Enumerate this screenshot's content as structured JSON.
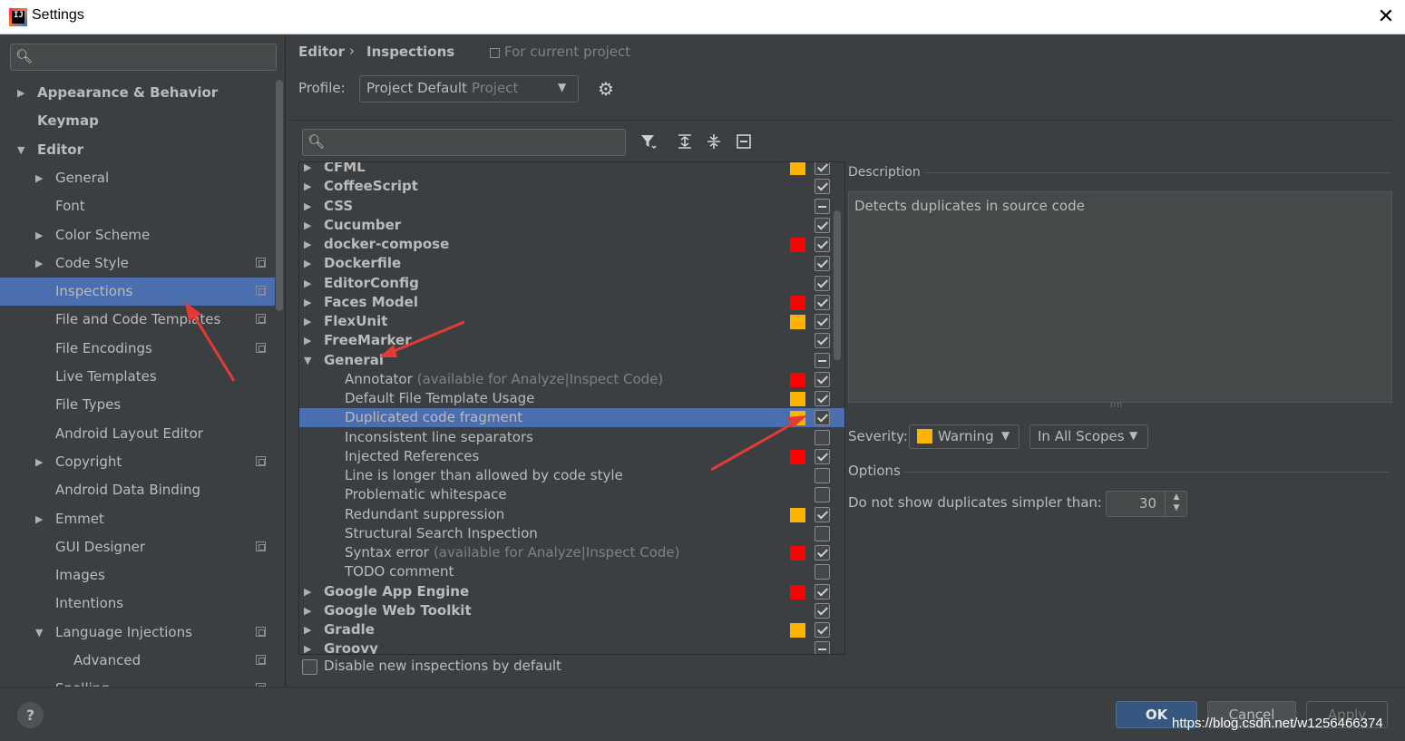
{
  "window": {
    "title": "Settings",
    "close_glyph": "✕"
  },
  "left": {
    "search_placeholder": "",
    "items": [
      {
        "label": "Appearance & Behavior",
        "level": 0,
        "arrow": "▶",
        "bold": true
      },
      {
        "label": "Keymap",
        "level": 0,
        "arrow": "",
        "bold": true
      },
      {
        "label": "Editor",
        "level": 0,
        "arrow": "▼",
        "bold": true
      },
      {
        "label": "General",
        "level": 1,
        "arrow": "▶"
      },
      {
        "label": "Font",
        "level": 1,
        "arrow": ""
      },
      {
        "label": "Color Scheme",
        "level": 1,
        "arrow": "▶"
      },
      {
        "label": "Code Style",
        "level": 1,
        "arrow": "▶",
        "project": true
      },
      {
        "label": "Inspections",
        "level": 1,
        "arrow": "",
        "project": true,
        "selected": true
      },
      {
        "label": "File and Code Templates",
        "level": 1,
        "arrow": "",
        "project": true
      },
      {
        "label": "File Encodings",
        "level": 1,
        "arrow": "",
        "project": true
      },
      {
        "label": "Live Templates",
        "level": 1,
        "arrow": ""
      },
      {
        "label": "File Types",
        "level": 1,
        "arrow": ""
      },
      {
        "label": "Android Layout Editor",
        "level": 1,
        "arrow": ""
      },
      {
        "label": "Copyright",
        "level": 1,
        "arrow": "▶",
        "project": true
      },
      {
        "label": "Android Data Binding",
        "level": 1,
        "arrow": ""
      },
      {
        "label": "Emmet",
        "level": 1,
        "arrow": "▶"
      },
      {
        "label": "GUI Designer",
        "level": 1,
        "arrow": "",
        "project": true
      },
      {
        "label": "Images",
        "level": 1,
        "arrow": ""
      },
      {
        "label": "Intentions",
        "level": 1,
        "arrow": ""
      },
      {
        "label": "Language Injections",
        "level": 1,
        "arrow": "▼",
        "project": true
      },
      {
        "label": "Advanced",
        "level": 2,
        "arrow": "",
        "project": true
      },
      {
        "label": "Spelling",
        "level": 1,
        "arrow": "",
        "project": true
      }
    ]
  },
  "header": {
    "breadcrumb_editor": "Editor",
    "breadcrumb_sep": "›",
    "breadcrumb_inspections": "Inspections",
    "scope_note": "For current project",
    "profile_label": "Profile:",
    "profile_value": "Project Default",
    "profile_scope": "Project"
  },
  "inspections": [
    {
      "label": "CFML",
      "type": "group",
      "arrow": "▶",
      "severity": "#fdb400",
      "check": "checked"
    },
    {
      "label": "CoffeeScript",
      "type": "group",
      "arrow": "▶",
      "severity": "",
      "check": "checked"
    },
    {
      "label": "CSS",
      "type": "group",
      "arrow": "▶",
      "severity": "",
      "check": "mixed"
    },
    {
      "label": "Cucumber",
      "type": "group",
      "arrow": "▶",
      "severity": "",
      "check": "checked"
    },
    {
      "label": "docker-compose",
      "type": "group",
      "arrow": "▶",
      "severity": "#ff0000",
      "check": "checked"
    },
    {
      "label": "Dockerfile",
      "type": "group",
      "arrow": "▶",
      "severity": "",
      "check": "checked"
    },
    {
      "label": "EditorConfig",
      "type": "group",
      "arrow": "▶",
      "severity": "",
      "check": "checked"
    },
    {
      "label": "Faces Model",
      "type": "group",
      "arrow": "▶",
      "severity": "#ff0000",
      "check": "checked"
    },
    {
      "label": "FlexUnit",
      "type": "group",
      "arrow": "▶",
      "severity": "#fdb400",
      "check": "checked"
    },
    {
      "label": "FreeMarker",
      "type": "group",
      "arrow": "▶",
      "severity": "",
      "check": "checked"
    },
    {
      "label": "General",
      "type": "group",
      "arrow": "▼",
      "severity": "",
      "check": "mixed"
    },
    {
      "label": "Annotator",
      "note": "(available for Analyze|Inspect Code)",
      "type": "child",
      "severity": "#ff0000",
      "check": "checked"
    },
    {
      "label": "Default File Template Usage",
      "type": "child",
      "severity": "#fdb400",
      "check": "checked"
    },
    {
      "label": "Duplicated code fragment",
      "type": "child",
      "severity": "#fdb400",
      "check": "checked",
      "selected": true
    },
    {
      "label": "Inconsistent line separators",
      "type": "child",
      "severity": "",
      "check": "unchecked"
    },
    {
      "label": "Injected References",
      "type": "child",
      "severity": "#ff0000",
      "check": "checked"
    },
    {
      "label": "Line is longer than allowed by code style",
      "type": "child",
      "severity": "",
      "check": "unchecked"
    },
    {
      "label": "Problematic whitespace",
      "type": "child",
      "severity": "",
      "check": "unchecked"
    },
    {
      "label": "Redundant suppression",
      "type": "child",
      "severity": "#fdb400",
      "check": "checked"
    },
    {
      "label": "Structural Search Inspection",
      "type": "child",
      "severity": "",
      "check": "unchecked"
    },
    {
      "label": "Syntax error",
      "note": "(available for Analyze|Inspect Code)",
      "type": "child",
      "severity": "#ff0000",
      "check": "checked"
    },
    {
      "label": "TODO comment",
      "type": "child",
      "severity": "",
      "check": "unchecked"
    },
    {
      "label": "Google App Engine",
      "type": "group",
      "arrow": "▶",
      "severity": "#ff0000",
      "check": "checked"
    },
    {
      "label": "Google Web Toolkit",
      "type": "group",
      "arrow": "▶",
      "severity": "",
      "check": "checked"
    },
    {
      "label": "Gradle",
      "type": "group",
      "arrow": "▶",
      "severity": "#fdb400",
      "check": "checked"
    },
    {
      "label": "Groovy",
      "type": "group",
      "arrow": "▶",
      "severity": "",
      "check": "mixed"
    }
  ],
  "disable_new_label": "Disable new inspections by default",
  "details": {
    "description_label": "Description",
    "description_text": "Detects duplicates in source code",
    "severity_label": "Severity:",
    "severity_value": "Warning",
    "severity_color": "#fdb400",
    "scope_value": "In All Scopes",
    "options_label": "Options",
    "dup_label": "Do not show duplicates simpler than:",
    "dup_value": "30"
  },
  "footer": {
    "help": "?",
    "ok": "OK",
    "cancel": "Cancel",
    "apply": "Apply",
    "watermark": "https://blog.csdn.net/w1256466374"
  },
  "colors": {
    "accent": "#4b6eaf",
    "annotation_arrow": "#e53935",
    "error": "#ff0000",
    "warning": "#fdb400"
  }
}
